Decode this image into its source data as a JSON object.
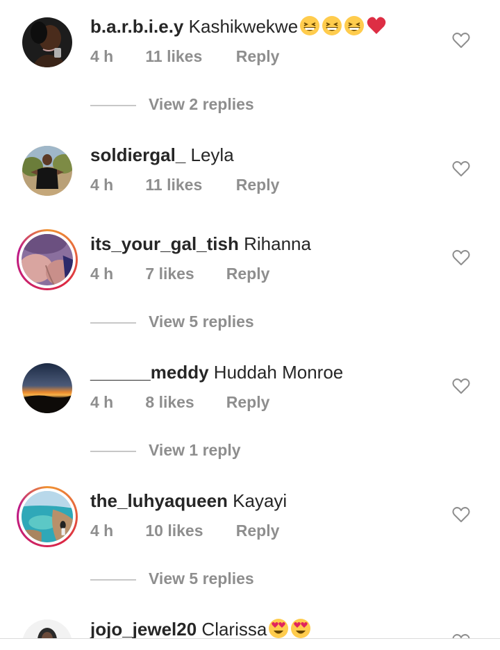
{
  "comments": [
    {
      "username": "b.a.r.b.i.e.y",
      "text": "Kashikwekwe",
      "emojis": [
        "grin-squint-emoji",
        "grin-squint-emoji",
        "grin-squint-emoji",
        "red-heart-emoji"
      ],
      "time": "4 h",
      "likes": "11 likes",
      "reply_label": "Reply",
      "view_replies": "View 2 replies",
      "has_story": false
    },
    {
      "username": "soldiergal_",
      "text": "Leyla",
      "emojis": [],
      "time": "4 h",
      "likes": "11 likes",
      "reply_label": "Reply",
      "view_replies": "",
      "has_story": false
    },
    {
      "username": "its_your_gal_tish",
      "text": "Rihanna",
      "emojis": [],
      "time": "4 h",
      "likes": "7 likes",
      "reply_label": "Reply",
      "view_replies": "View 5 replies",
      "has_story": true
    },
    {
      "username": "______meddy",
      "text": "Huddah Monroe",
      "emojis": [],
      "time": "4 h",
      "likes": "8 likes",
      "reply_label": "Reply",
      "view_replies": "View 1 reply",
      "has_story": false
    },
    {
      "username": "the_luhyaqueen",
      "text": "Kayayi",
      "emojis": [],
      "time": "4 h",
      "likes": "10 likes",
      "reply_label": "Reply",
      "view_replies": "View 5 replies",
      "has_story": true
    },
    {
      "username": "jojo_jewel20",
      "text": "Clarissa",
      "emojis": [
        "heart-eyes-emoji",
        "heart-eyes-emoji"
      ],
      "time": "",
      "likes": "",
      "reply_label": "",
      "view_replies": "",
      "has_story": false
    }
  ],
  "icons": {
    "like": "heart-outline-icon"
  },
  "colors": {
    "text": "#262626",
    "meta": "#8e8e8e",
    "divider": "#c7c7c7",
    "heart_emoji": "#e0245e",
    "emoji_face": "#ffcc4d"
  }
}
